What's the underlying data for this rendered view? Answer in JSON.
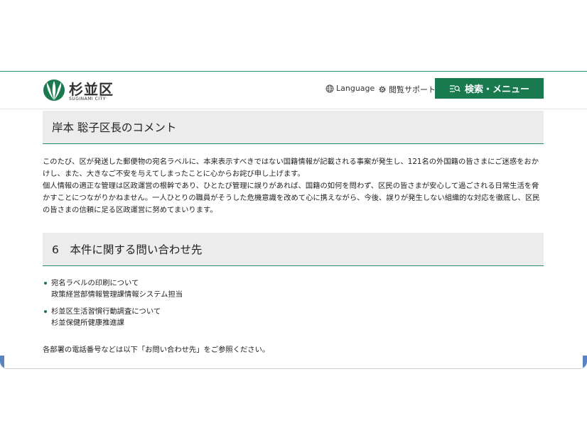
{
  "header": {
    "logo_text": "杉並区",
    "logo_sub": "SUGINAMI CITY",
    "language_label": "Language",
    "support_label": "閲覧サポート",
    "menu_button_label": "検索・メニュー"
  },
  "comment_section": {
    "heading": "岸本 聡子区長のコメント",
    "paragraphs": [
      "このたび、区が発送した郵便物の宛名ラベルに、本来表示すべきではない国籍情報が記載される事案が発生し、121名の外国籍の皆さまにご迷惑をおかけし、また、大きなご不安を与えてしまったことに心からお詫び申し上げます。",
      "個人情報の適正な管理は区政運営の根幹であり、ひとたび管理に誤りがあれば、国籍の如何を問わず、区民の皆さまが安心して過ごされる日常生活を脅かすことにつながりかねません。一人ひとりの職員がそうした危機意識を改めて心に携えながら、今後、誤りが発生しない組織的な対応を徹底し、区民の皆さまの信頼に足る区政運営に努めてまいります。"
    ]
  },
  "contact_section": {
    "heading": "6　本件に関する問い合わせ先",
    "items": [
      {
        "title": "宛名ラベルの印刷について",
        "dept": "政策経営部情報管理課情報システム担当"
      },
      {
        "title": "杉並区生活習慣行動調査について",
        "dept": "杉並保健所健康推進課"
      }
    ],
    "note": "各部署の電話番号などは以下「お問い合わせ先」をご参照ください。"
  },
  "colors": {
    "brand_green": "#1a7a4f",
    "heading_bg": "#ececec"
  }
}
